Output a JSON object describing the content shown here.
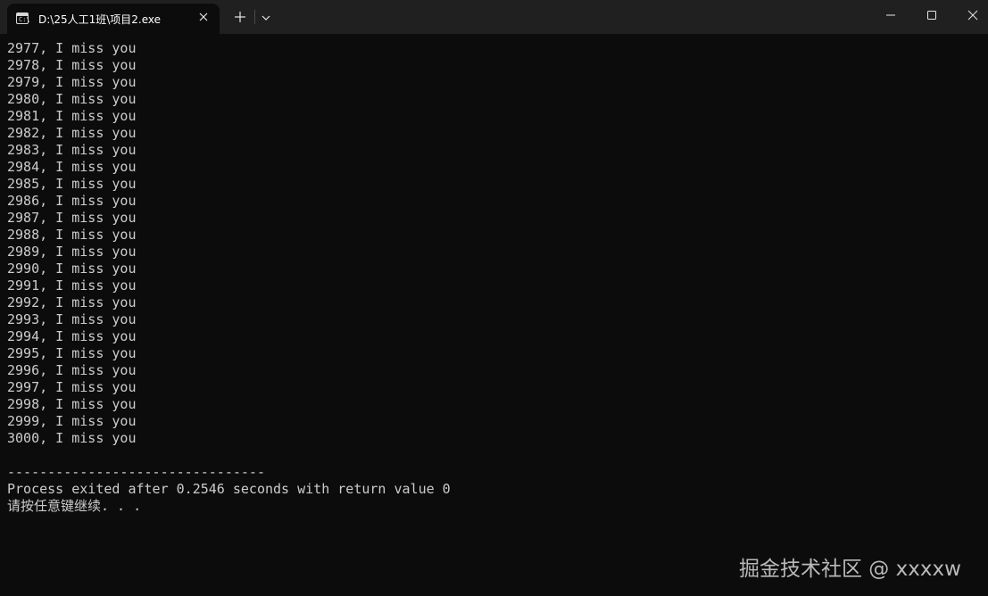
{
  "tab": {
    "title": "D:\\25人工1班\\项目2.exe",
    "icon": "terminal-icon",
    "close_icon": "close-icon"
  },
  "tabbar": {
    "new_tab_icon": "plus-icon",
    "dropdown_icon": "chevron-down-icon"
  },
  "window_controls": {
    "minimize_icon": "minimize-icon",
    "maximize_icon": "maximize-icon",
    "close_icon": "close-icon"
  },
  "console": {
    "lines": [
      "2977, I miss you",
      "2978, I miss you",
      "2979, I miss you",
      "2980, I miss you",
      "2981, I miss you",
      "2982, I miss you",
      "2983, I miss you",
      "2984, I miss you",
      "2985, I miss you",
      "2986, I miss you",
      "2987, I miss you",
      "2988, I miss you",
      "2989, I miss you",
      "2990, I miss you",
      "2991, I miss you",
      "2992, I miss you",
      "2993, I miss you",
      "2994, I miss you",
      "2995, I miss you",
      "2996, I miss you",
      "2997, I miss you",
      "2998, I miss you",
      "2999, I miss you",
      "3000, I miss you"
    ],
    "separator": "--------------------------------",
    "process_message": "Process exited after 0.2546 seconds with return value 0",
    "continue_prompt": "请按任意键继续. . ."
  },
  "watermark": "掘金技术社区 @ xxxxw",
  "colors": {
    "background": "#0c0c0c",
    "titlebar": "#202020",
    "text": "#cccccc"
  }
}
